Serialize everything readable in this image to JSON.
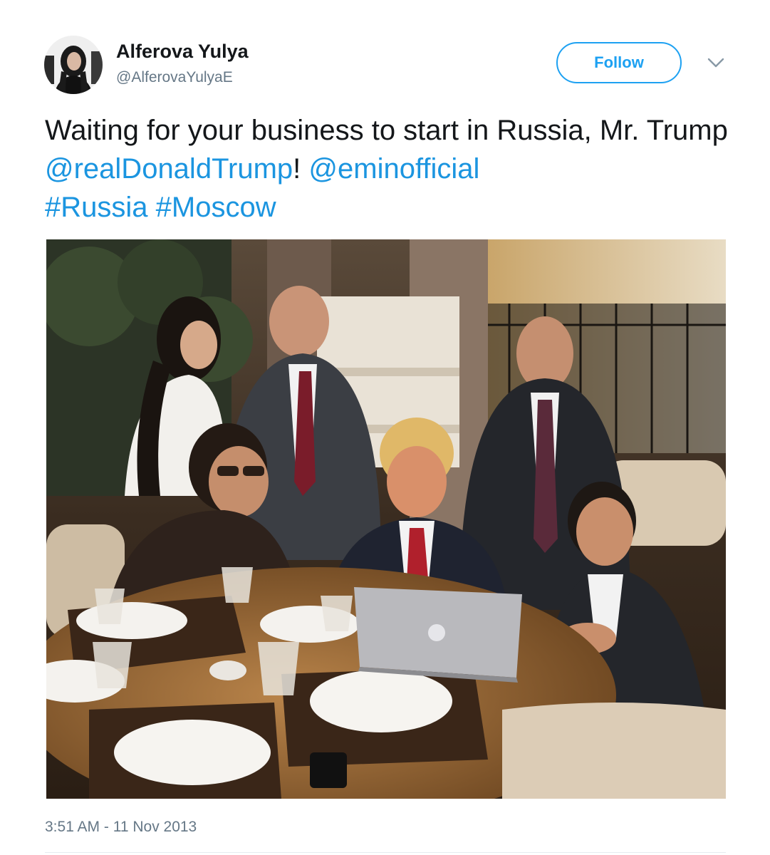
{
  "user": {
    "display_name": "Alferova Yulya",
    "handle": "@AlferovaYulyaE",
    "avatar_icon": "profile-photo"
  },
  "follow_button": {
    "label": "Follow"
  },
  "menu": {
    "icon": "chevron-down-icon"
  },
  "tweet": {
    "text_part1": "Waiting for your business to start in Russia, Mr. Trump ",
    "mention1": "@realDonaldTrump",
    "text_part2": "! ",
    "mention2": "@eminofficial",
    "text_part3": " ",
    "hashtag1": "#Russia",
    "text_part4": " ",
    "hashtag2": "#Moscow"
  },
  "photo": {
    "subject": "group-photo-restaurant-laptop"
  },
  "timestamp": "3:51 AM - 11 Nov 2013",
  "colors": {
    "link": "#1b95e0",
    "follow_border": "#1da1f2",
    "secondary_text": "#657786",
    "primary_text": "#14171a"
  }
}
